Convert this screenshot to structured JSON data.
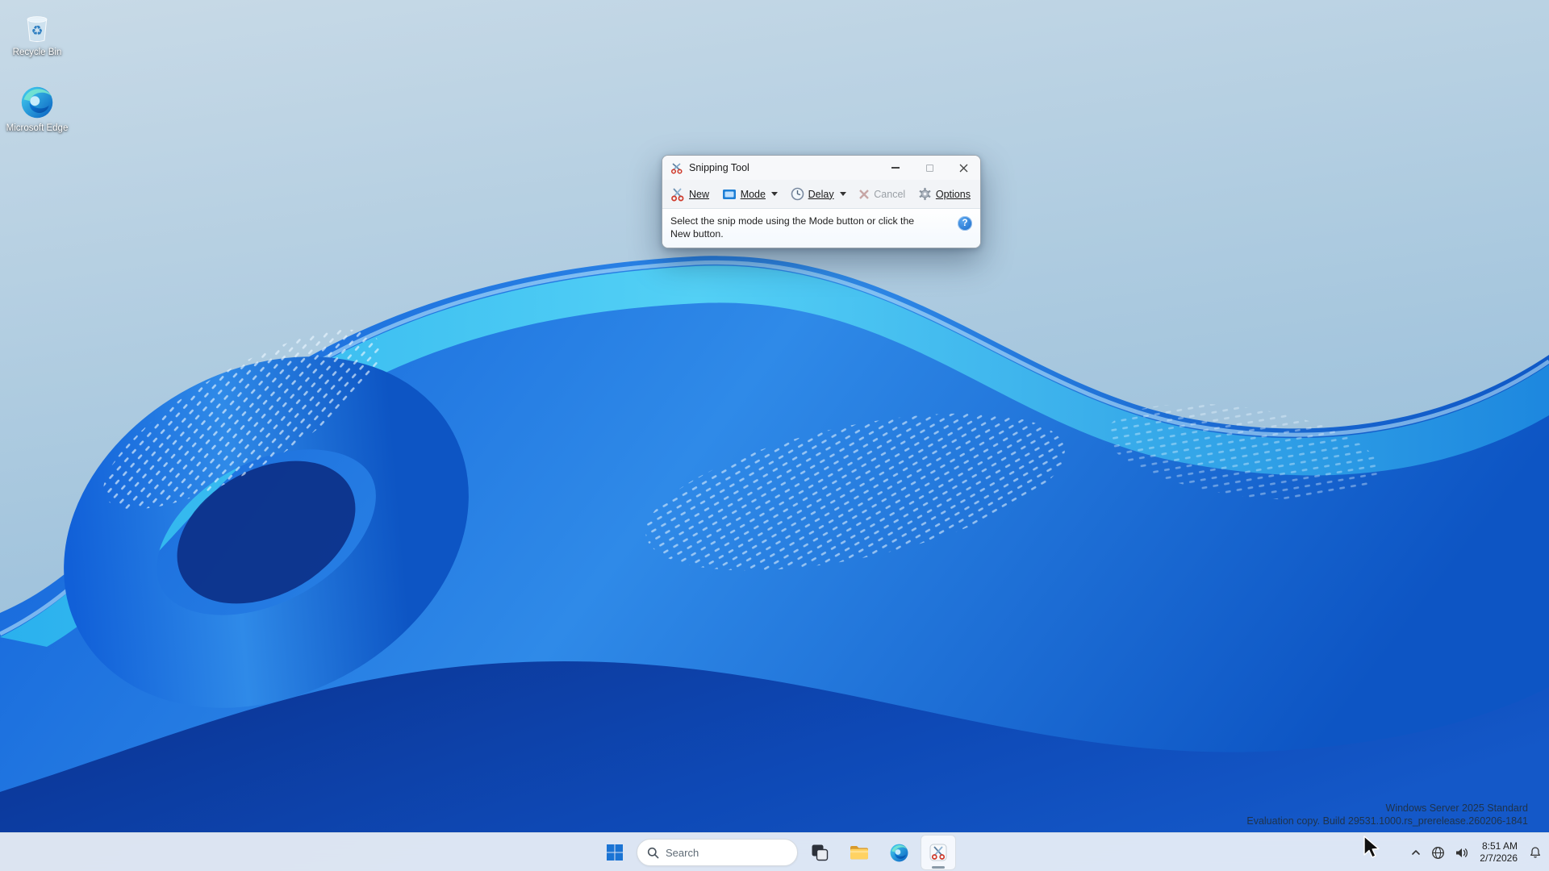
{
  "desktop": {
    "icons": [
      {
        "label": "Recycle Bin"
      },
      {
        "label": "Microsoft Edge"
      }
    ],
    "watermark": {
      "line1": "Windows Server 2025 Standard",
      "line2": "Evaluation copy. Build 29531.1000.rs_prerelease.260206-1841"
    }
  },
  "snipping_tool": {
    "title": "Snipping Tool",
    "toolbar": {
      "new": "New",
      "mode": "Mode",
      "delay": "Delay",
      "cancel": "Cancel",
      "options": "Options"
    },
    "message": "Select the snip mode using the Mode button or click the New button.",
    "help_glyph": "?"
  },
  "taskbar": {
    "search_placeholder": "Search",
    "clock": {
      "time": "8:51 AM",
      "date": "2/7/2026"
    }
  },
  "colors": {
    "accent": "#1b74d4",
    "window_bg": "#f2f4f7",
    "taskbar_bg": "#f3f6fa"
  }
}
